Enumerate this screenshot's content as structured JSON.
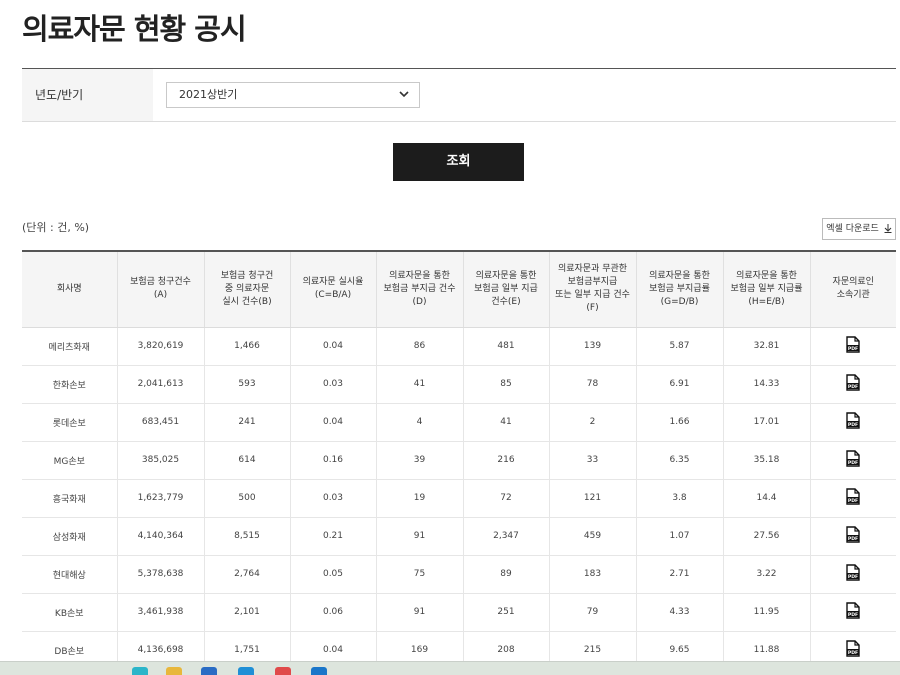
{
  "page": {
    "title": "의료자문 현황 공시"
  },
  "filter": {
    "label": "년도/반기",
    "selected": "2021상반기"
  },
  "search_button": "조회",
  "unit_text": "(단위 : 건, %)",
  "excel_button": "엑셀 다운로드",
  "table": {
    "headers": [
      "회사명",
      "보험금 청구건수\n(A)",
      "보험금 청구건\n중 의료자문\n실시 건수(B)",
      "의료자문 실시율\n(C=B/A)",
      "의료자문을 통한\n보험금 부지급 건수\n(D)",
      "의료자문을 통한\n보험금 일부 지급\n건수(E)",
      "의료자문과 무관한\n보험금부지급\n또는 일부 지급 건수\n(F)",
      "의료자문을 통한\n보험금 부지급률\n(G=D/B)",
      "의료자문을 통한\n보험금 일부 지급률\n(H=E/B)",
      "자문의료인\n소속기관"
    ],
    "rows": [
      [
        "메리츠화재",
        "3,820,619",
        "1,466",
        "0.04",
        "86",
        "481",
        "139",
        "5.87",
        "32.81"
      ],
      [
        "한화손보",
        "2,041,613",
        "593",
        "0.03",
        "41",
        "85",
        "78",
        "6.91",
        "14.33"
      ],
      [
        "롯데손보",
        "683,451",
        "241",
        "0.04",
        "4",
        "41",
        "2",
        "1.66",
        "17.01"
      ],
      [
        "MG손보",
        "385,025",
        "614",
        "0.16",
        "39",
        "216",
        "33",
        "6.35",
        "35.18"
      ],
      [
        "흥국화재",
        "1,623,779",
        "500",
        "0.03",
        "19",
        "72",
        "121",
        "3.8",
        "14.4"
      ],
      [
        "삼성화재",
        "4,140,364",
        "8,515",
        "0.21",
        "91",
        "2,347",
        "459",
        "1.07",
        "27.56"
      ],
      [
        "현대해상",
        "5,378,638",
        "2,764",
        "0.05",
        "75",
        "89",
        "183",
        "2.71",
        "3.22"
      ],
      [
        "KB손보",
        "3,461,938",
        "2,101",
        "0.06",
        "91",
        "251",
        "79",
        "4.33",
        "11.95"
      ],
      [
        "DB손보",
        "4,136,698",
        "1,751",
        "0.04",
        "169",
        "208",
        "215",
        "9.65",
        "11.88"
      ]
    ]
  },
  "icons": {
    "pdf": "pdf-file-icon",
    "select_arrow": "chevron-down-icon",
    "download": "download-icon"
  }
}
